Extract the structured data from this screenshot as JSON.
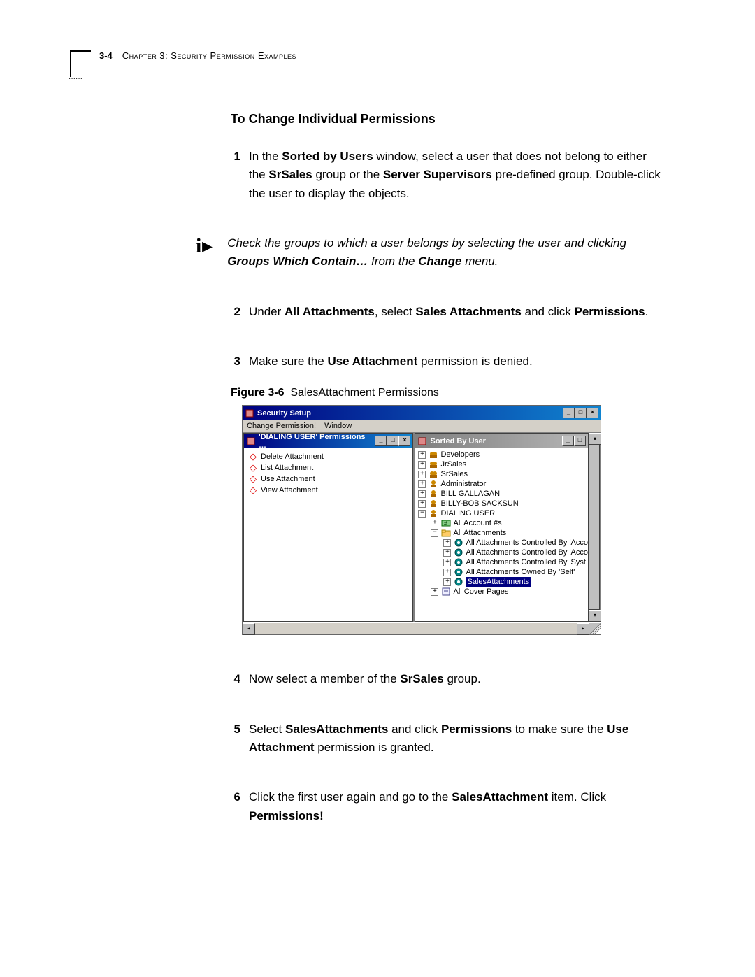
{
  "header": {
    "page_number": "3-4",
    "chapter": "Chapter 3: Security Permission Examples"
  },
  "section_title": "To Change Individual Permissions",
  "steps": {
    "s1": {
      "num": "1",
      "prefix": "In the ",
      "bold1": "Sorted by Users",
      "mid1": " window, select a user that does not belong to either the ",
      "bold2": "SrSales",
      "mid2": " group or the ",
      "bold3": "Server Supervisors",
      "suffix": " pre-defined group. Double-click the user to display the objects."
    },
    "info": {
      "line1": "Check the groups to which a user belongs by selecting the user and clicking ",
      "bold1": "Groups Which Contain…",
      "mid": " from the ",
      "bold2": "Change",
      "suffix": " menu."
    },
    "s2": {
      "num": "2",
      "prefix": "Under ",
      "bold1": "All Attachments",
      "mid1": ", select ",
      "bold2": "Sales Attachments",
      "mid2": " and click ",
      "bold3": "Permissions",
      "suffix": "."
    },
    "s3": {
      "num": "3",
      "prefix": "Make sure the ",
      "bold1": "Use Attachment",
      "suffix": " permission is denied."
    },
    "s4": {
      "num": "4",
      "prefix": "Now select a member of the ",
      "bold1": "SrSales",
      "suffix": " group."
    },
    "s5": {
      "num": "5",
      "prefix": "Select ",
      "bold1": "SalesAttachments",
      "mid1": " and click ",
      "bold2": "Permissions",
      "mid2": " to make sure the ",
      "bold3": "Use Attachment",
      "suffix": " permission is granted."
    },
    "s6": {
      "num": "6",
      "prefix": "Click the first user again and go to the ",
      "bold1": "SalesAttachment",
      "mid1": " item. Click ",
      "bold2": "Permissions!"
    }
  },
  "figure": {
    "label": "Figure 3-6",
    "caption": "SalesAttachment Permissions"
  },
  "screenshot": {
    "outer_title": "Security Setup",
    "menu": {
      "change_permission": "Change Permission!",
      "window": "Window"
    },
    "left_window": {
      "title": "'DIALING USER' Permissions …",
      "items": [
        "Delete Attachment",
        "List Attachment",
        "Use Attachment",
        "View Attachment"
      ]
    },
    "right_window": {
      "title": "Sorted By User",
      "tree": [
        {
          "indent": 0,
          "exp": "+",
          "icon": "group",
          "label": "Developers"
        },
        {
          "indent": 0,
          "exp": "+",
          "icon": "group",
          "label": "JrSales"
        },
        {
          "indent": 0,
          "exp": "+",
          "icon": "group",
          "label": "SrSales"
        },
        {
          "indent": 0,
          "exp": "+",
          "icon": "user",
          "label": "Administrator"
        },
        {
          "indent": 0,
          "exp": "+",
          "icon": "user",
          "label": "BILL GALLAGAN"
        },
        {
          "indent": 0,
          "exp": "+",
          "icon": "user",
          "label": "BILLY-BOB SACKSUN"
        },
        {
          "indent": 0,
          "exp": "−",
          "icon": "user",
          "label": "DIALING USER"
        },
        {
          "indent": 1,
          "exp": "+",
          "icon": "accounts",
          "label": "All Account #s"
        },
        {
          "indent": 1,
          "exp": "−",
          "icon": "folder",
          "label": "All Attachments"
        },
        {
          "indent": 2,
          "exp": "+",
          "icon": "attach",
          "label": "All Attachments Controlled By 'Acco"
        },
        {
          "indent": 2,
          "exp": "+",
          "icon": "attach",
          "label": "All Attachments Controlled By 'Acco"
        },
        {
          "indent": 2,
          "exp": "+",
          "icon": "attach",
          "label": "All Attachments Controlled By 'Syst"
        },
        {
          "indent": 2,
          "exp": "+",
          "icon": "attach",
          "label": "All Attachments Owned By 'Self'"
        },
        {
          "indent": 2,
          "exp": "+",
          "icon": "attach",
          "label": "SalesAttachments",
          "selected": true
        },
        {
          "indent": 1,
          "exp": "+",
          "icon": "cover",
          "label": "All Cover Pages"
        }
      ]
    }
  }
}
